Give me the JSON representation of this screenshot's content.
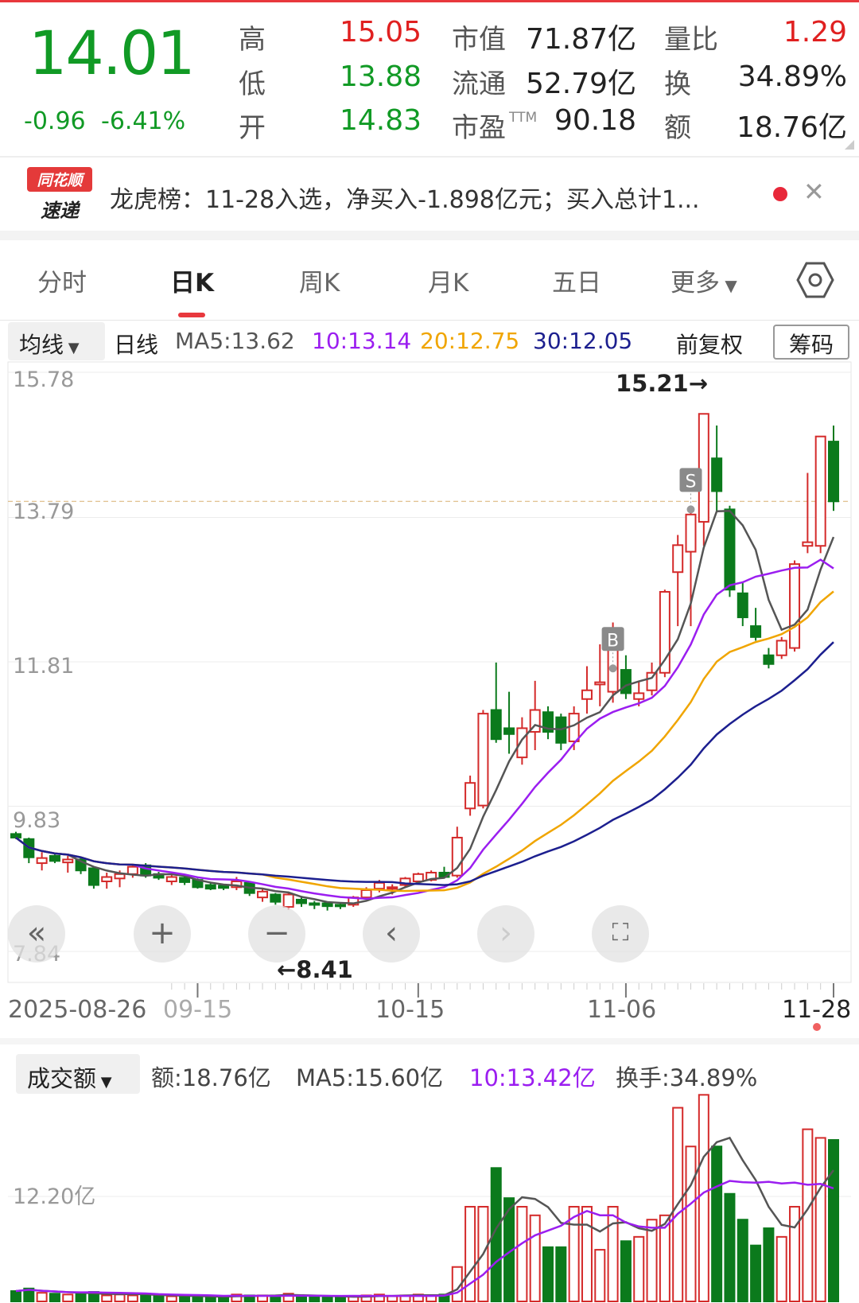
{
  "quote": {
    "price": "14.01",
    "change": "-0.96",
    "change_pct": "-6.41%",
    "high_label": "高",
    "high": "15.05",
    "low_label": "低",
    "low": "13.88",
    "open_label": "开",
    "open": "14.83",
    "mktcap_label": "市值",
    "mktcap": "71.87亿",
    "float_label": "流通",
    "float": "52.79亿",
    "pe_label": "市盈",
    "pe_sup": "TTM",
    "pe": "90.18",
    "vr_label": "量比",
    "vr": "1.29",
    "turnover_label": "换",
    "turnover": "34.89%",
    "amount_label": "额",
    "amount": "18.76亿"
  },
  "banner": {
    "logo_top": "同花顺",
    "logo_bottom": "速递",
    "text": "龙虎榜：11-28入选，净买入-1.898亿元；买入总计1..."
  },
  "tabs": [
    {
      "label": "分时"
    },
    {
      "label": "日K"
    },
    {
      "label": "周K"
    },
    {
      "label": "月K"
    },
    {
      "label": "五日"
    },
    {
      "label": "更多"
    }
  ],
  "ma_bar": {
    "selector": "均线",
    "period": "日线",
    "ma5": "MA5:13.62",
    "ma10": "10:13.14",
    "ma20": "20:12.75",
    "ma30": "30:12.05",
    "adjust": "前复权",
    "chips": "筹码"
  },
  "colors": {
    "up": "#d42a2a",
    "down": "#0b7a1c",
    "ma5": "#555555",
    "ma10": "#9b1ef0",
    "ma20": "#f0a500",
    "ma30": "#1c1f8f"
  },
  "chart_data": {
    "type": "candlestick",
    "price_ticks": [
      "15.78",
      "13.79",
      "11.81",
      "9.83",
      "7.84"
    ],
    "ylim": [
      7.84,
      15.78
    ],
    "last_close": 14.01,
    "x_ticks": [
      {
        "label": "2025-08-26",
        "index": 0
      },
      {
        "label": "09-15",
        "index": 14
      },
      {
        "label": "10-15",
        "index": 31
      },
      {
        "label": "11-06",
        "index": 47
      },
      {
        "label": "11-28",
        "index": 63
      }
    ],
    "annotations": {
      "high": "15.21→",
      "low": "←8.41",
      "buy": "B",
      "sell": "S"
    },
    "ohlc": [
      [
        9.45,
        9.48,
        9.38,
        9.4
      ],
      [
        9.38,
        9.4,
        9.05,
        9.13
      ],
      [
        9.05,
        9.2,
        8.95,
        9.12
      ],
      [
        9.15,
        9.17,
        9.05,
        9.08
      ],
      [
        9.06,
        9.15,
        8.92,
        9.1
      ],
      [
        9.1,
        9.12,
        8.9,
        8.95
      ],
      [
        8.98,
        9.0,
        8.7,
        8.75
      ],
      [
        8.8,
        8.92,
        8.7,
        8.86
      ],
      [
        8.84,
        8.95,
        8.72,
        8.9
      ],
      [
        8.9,
        9.02,
        8.85,
        9.0
      ],
      [
        9.02,
        9.05,
        8.85,
        8.88
      ],
      [
        8.9,
        8.93,
        8.82,
        8.85
      ],
      [
        8.8,
        8.9,
        8.75,
        8.86
      ],
      [
        8.85,
        8.87,
        8.75,
        8.79
      ],
      [
        8.82,
        8.84,
        8.7,
        8.72
      ],
      [
        8.75,
        8.78,
        8.68,
        8.7
      ],
      [
        8.74,
        8.76,
        8.68,
        8.71
      ],
      [
        8.72,
        8.86,
        8.68,
        8.8
      ],
      [
        8.78,
        8.8,
        8.6,
        8.64
      ],
      [
        8.58,
        8.7,
        8.52,
        8.66
      ],
      [
        8.62,
        8.64,
        8.48,
        8.52
      ],
      [
        8.45,
        8.66,
        8.41,
        8.62
      ],
      [
        8.55,
        8.6,
        8.45,
        8.5
      ],
      [
        8.5,
        8.53,
        8.42,
        8.48
      ],
      [
        8.5,
        8.52,
        8.4,
        8.46
      ],
      [
        8.48,
        8.5,
        8.42,
        8.47
      ],
      [
        8.48,
        8.6,
        8.45,
        8.58
      ],
      [
        8.58,
        8.72,
        8.55,
        8.68
      ],
      [
        8.7,
        8.82,
        8.65,
        8.78
      ],
      [
        8.7,
        8.76,
        8.62,
        8.72
      ],
      [
        8.75,
        8.86,
        8.72,
        8.84
      ],
      [
        8.8,
        8.92,
        8.78,
        8.9
      ],
      [
        8.82,
        8.95,
        8.8,
        8.92
      ],
      [
        8.92,
        9.0,
        8.84,
        8.86
      ],
      [
        8.88,
        9.55,
        8.85,
        9.4
      ],
      [
        9.8,
        10.25,
        9.7,
        10.15
      ],
      [
        9.84,
        11.15,
        9.8,
        11.1
      ],
      [
        11.15,
        11.8,
        10.7,
        10.75
      ],
      [
        10.9,
        11.4,
        10.55,
        10.82
      ],
      [
        10.5,
        11.05,
        10.4,
        10.9
      ],
      [
        10.85,
        11.55,
        10.6,
        11.15
      ],
      [
        11.12,
        11.2,
        10.75,
        10.85
      ],
      [
        11.05,
        11.1,
        10.6,
        10.7
      ],
      [
        10.72,
        11.2,
        10.6,
        11.1
      ],
      [
        11.3,
        11.75,
        11.1,
        11.42
      ],
      [
        11.5,
        12.05,
        11.2,
        11.53
      ],
      [
        11.4,
        12.35,
        11.25,
        12.0
      ],
      [
        11.7,
        11.9,
        11.3,
        11.38
      ],
      [
        11.3,
        11.55,
        11.2,
        11.38
      ],
      [
        11.42,
        11.8,
        11.35,
        11.66
      ],
      [
        11.66,
        12.8,
        11.6,
        12.77
      ],
      [
        13.04,
        13.55,
        12.3,
        13.41
      ],
      [
        13.32,
        13.9,
        12.3,
        13.83
      ],
      [
        13.73,
        15.21,
        13.4,
        15.21
      ],
      [
        14.6,
        15.05,
        13.88,
        14.15
      ],
      [
        13.9,
        13.95,
        12.7,
        12.8
      ],
      [
        12.75,
        12.9,
        12.3,
        12.42
      ],
      [
        12.3,
        12.55,
        12.1,
        12.15
      ],
      [
        11.9,
        12.0,
        11.72,
        11.78
      ],
      [
        11.9,
        12.15,
        11.85,
        12.1
      ],
      [
        12.0,
        13.2,
        11.95,
        13.15
      ],
      [
        13.4,
        14.4,
        13.3,
        13.45
      ],
      [
        13.4,
        14.9,
        13.3,
        14.9
      ],
      [
        14.83,
        15.05,
        13.88,
        14.01
      ]
    ],
    "volume": {
      "unit": "亿",
      "tick": "12.20亿",
      "tick_value": 12.2,
      "values": [
        1.2,
        1.5,
        1.0,
        0.9,
        0.8,
        0.9,
        1.1,
        0.7,
        0.8,
        0.7,
        0.9,
        0.6,
        0.6,
        0.5,
        0.6,
        0.6,
        0.5,
        0.8,
        0.7,
        0.7,
        0.7,
        0.9,
        0.6,
        0.5,
        0.5,
        0.5,
        0.6,
        0.7,
        0.8,
        0.6,
        0.7,
        0.8,
        0.7,
        0.8,
        4.0,
        11.0,
        11.0,
        15.5,
        12.0,
        11.0,
        10.0,
        6.3,
        6.3,
        11.0,
        11.0,
        6.0,
        11.0,
        7.0,
        7.5,
        9.5,
        10.0,
        22.5,
        18.0,
        24.0,
        18.0,
        12.5,
        9.5,
        6.5,
        8.5,
        7.5,
        11.0,
        20.0,
        19.0,
        18.76
      ]
    }
  },
  "volume_bar": {
    "selector": "成交额",
    "amount": "额:18.76亿",
    "ma5": "MA5:15.60亿",
    "ma10": "10:13.42亿",
    "turnover": "换手:34.89%"
  }
}
